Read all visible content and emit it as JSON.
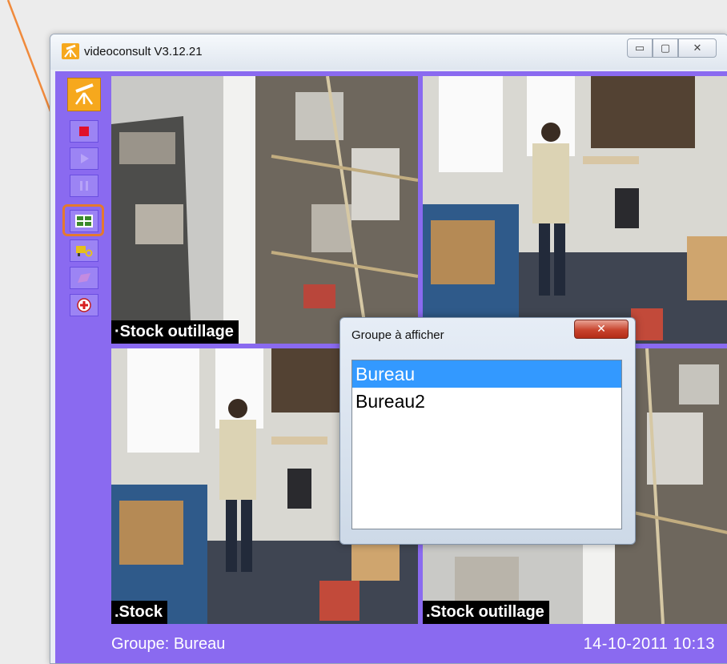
{
  "window": {
    "title": "videoconsult V3.12.21",
    "minimize_glyph": "▭",
    "maximize_glyph": "▢",
    "close_glyph": "✕"
  },
  "toolbar": {
    "items": [
      {
        "name": "logo",
        "icon": "telescope-icon"
      },
      {
        "name": "stop",
        "icon": "stop-icon"
      },
      {
        "name": "play",
        "icon": "play-icon"
      },
      {
        "name": "group",
        "icon": "grid-group-icon"
      },
      {
        "name": "camera",
        "icon": "camera-key-icon"
      },
      {
        "name": "export",
        "icon": "export-icon"
      },
      {
        "name": "help",
        "icon": "help-icon"
      }
    ]
  },
  "cameras": [
    {
      "label": "·Stock outillage"
    },
    {
      "label": ""
    },
    {
      "label": ".Stock"
    },
    {
      "label": ".Stock outillage"
    }
  ],
  "status": {
    "group": "Groupe: Bureau",
    "datetime": "14-10-2011  10:13"
  },
  "dialog": {
    "title": "Groupe à afficher",
    "close_glyph": "✕",
    "items": [
      {
        "label": "Bureau",
        "selected": true
      },
      {
        "label": "Bureau2",
        "selected": false
      }
    ]
  },
  "colors": {
    "accent_purple": "#8a6af0",
    "highlight_orange": "#e4792e",
    "selection_blue": "#3399ff"
  }
}
